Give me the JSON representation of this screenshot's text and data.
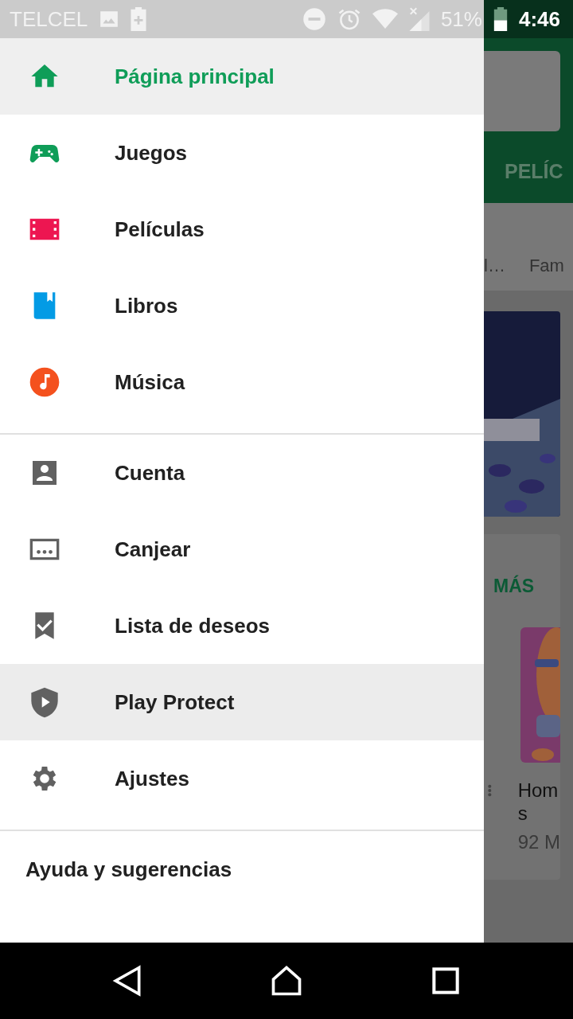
{
  "status_bar": {
    "carrier": "TELCEL",
    "battery": "51%",
    "time": "4:46"
  },
  "drawer": {
    "sections": [
      {
        "items": [
          {
            "kind": "home",
            "label": "Página principal",
            "color": "#0f9d58",
            "selected": true,
            "pressed": false
          },
          {
            "kind": "gamepad",
            "label": "Juegos",
            "color": "#0f9d58",
            "selected": false,
            "pressed": false
          },
          {
            "kind": "film",
            "label": "Películas",
            "color": "#ed1651",
            "selected": false,
            "pressed": false
          },
          {
            "kind": "book",
            "label": "Libros",
            "color": "#039be5",
            "selected": false,
            "pressed": false
          },
          {
            "kind": "music",
            "label": "Música",
            "color": "#f4511e",
            "selected": false,
            "pressed": false
          }
        ]
      },
      {
        "items": [
          {
            "kind": "account",
            "label": "Cuenta",
            "color": "#616161",
            "selected": false,
            "pressed": false
          },
          {
            "kind": "redeem",
            "label": "Canjear",
            "color": "#616161",
            "selected": false,
            "pressed": false
          },
          {
            "kind": "bookmark",
            "label": "Lista de deseos",
            "color": "#616161",
            "selected": false,
            "pressed": false
          },
          {
            "kind": "shield",
            "label": "Play Protect",
            "color": "#616161",
            "selected": false,
            "pressed": true
          },
          {
            "kind": "gear",
            "label": "Ajustes",
            "color": "#616161",
            "selected": false,
            "pressed": false
          }
        ]
      },
      {
        "items": [
          {
            "kind": "text",
            "label": "Ayuda y sugerencias",
            "selected": false,
            "pressed": false
          }
        ]
      }
    ]
  },
  "background": {
    "tab": "PELÍC",
    "categories": [
      "l…",
      "Fam"
    ],
    "more": "MÁS",
    "app_title": [
      "Hom",
      "s"
    ],
    "app_size": "92 M"
  }
}
